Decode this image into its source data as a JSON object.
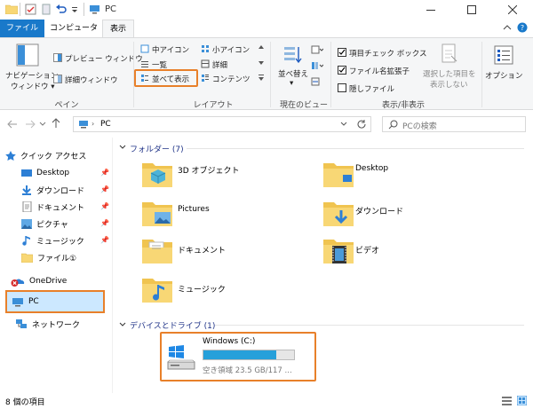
{
  "window": {
    "title": "PC"
  },
  "tabs": [
    {
      "label": "ファイル"
    },
    {
      "label": "コンピューター"
    },
    {
      "label": "表示"
    }
  ],
  "ribbon": {
    "pane": {
      "nav_pane_line1": "ナビゲーション",
      "nav_pane_line2": "ウィンドウ",
      "preview": "プレビュー ウィンドウ",
      "details": "詳細ウィンドウ",
      "group": "ペイン"
    },
    "layout": {
      "medium_icons": "中アイコン",
      "small_icons": "小アイコン",
      "list": "一覧",
      "details": "詳細",
      "tiles": "並べて表示",
      "content": "コンテンツ",
      "group": "レイアウト"
    },
    "current_view": {
      "sort_line1": "並べ替え",
      "group": "現在のビュー"
    },
    "show_hide": {
      "item_checkboxes": "項目チェック ボックス",
      "file_extensions": "ファイル名拡張子",
      "hidden_items": "隠しファイル",
      "hide_selected_line1": "選択した項目を",
      "hide_selected_line2": "表示しない",
      "group": "表示/非表示"
    },
    "options": {
      "label": "オプション"
    }
  },
  "address": {
    "path": "PC",
    "search_placeholder": "PCの検索"
  },
  "nav": {
    "quick_access": "クイック アクセス",
    "items": [
      "Desktop",
      "ダウンロード",
      "ドキュメント",
      "ピクチャ",
      "ミュージック",
      "ファイル①"
    ],
    "onedrive": "OneDrive",
    "pc": "PC",
    "network": "ネットワーク"
  },
  "main": {
    "folders_header": "フォルダー (7)",
    "folders": [
      "3D オブジェクト",
      "Desktop",
      "Pictures",
      "ダウンロード",
      "ドキュメント",
      "ビデオ",
      "ミュージック"
    ],
    "drives_header": "デバイスとドライブ (1)",
    "drive": {
      "name": "Windows (C:)",
      "space": "空き領域 23.5 GB/117 ...",
      "used_fraction": 0.8
    }
  },
  "status": {
    "count": "8 個の項目"
  },
  "colors": {
    "accent": "#1979ca",
    "highlight": "#e8802a",
    "folder": "#f8d775",
    "drive_bar": "#26a0da"
  }
}
